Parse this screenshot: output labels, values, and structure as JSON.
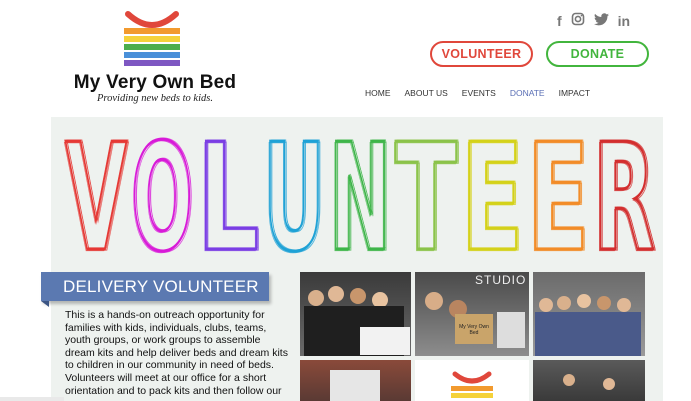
{
  "brand": {
    "name": "My Very Own Bed",
    "tagline": "Providing new beds to kids.",
    "logo_colors": [
      "#e0473b",
      "#f29a2e",
      "#f5d23a",
      "#4cae4c",
      "#4a90d9",
      "#7e57c2"
    ]
  },
  "social": [
    {
      "name": "facebook-icon",
      "glyph": "f"
    },
    {
      "name": "instagram-icon",
      "glyph": "◎"
    },
    {
      "name": "twitter-icon",
      "glyph": "🐦"
    },
    {
      "name": "linkedin-icon",
      "glyph": "in"
    }
  ],
  "header_buttons": {
    "volunteer": "VOLUNTEER",
    "donate": "DONATE"
  },
  "nav": {
    "items": [
      "HOME",
      "ABOUT US",
      "EVENTS",
      "DONATE",
      "IMPACT"
    ],
    "active": "DONATE"
  },
  "hero": {
    "letters": [
      {
        "ch": "V",
        "color": "#e53935"
      },
      {
        "ch": "O",
        "color": "#d81bd8"
      },
      {
        "ch": "L",
        "color": "#7b3fe4"
      },
      {
        "ch": "U",
        "color": "#1fa2d6"
      },
      {
        "ch": "N",
        "color": "#3fb54a"
      },
      {
        "ch": "T",
        "color": "#8bc34a"
      },
      {
        "ch": "E",
        "color": "#d4d11a"
      },
      {
        "ch": "E",
        "color": "#f28c28"
      },
      {
        "ch": "R",
        "color": "#d32f2f"
      }
    ]
  },
  "section": {
    "title": "DELIVERY VOLUNTEER",
    "body": "This is a hands-on outreach opportunity for families with kids, individuals, clubs, teams, youth groups, or work groups to assemble dream kits and help deliver beds and dream kits to children in our community in need of beds. Volunteers will meet at our office for a short orientation and to pack kits and then follow our"
  },
  "photos": {
    "studio_sign": "STUDIO",
    "box_label": "My Very Own Bed"
  }
}
